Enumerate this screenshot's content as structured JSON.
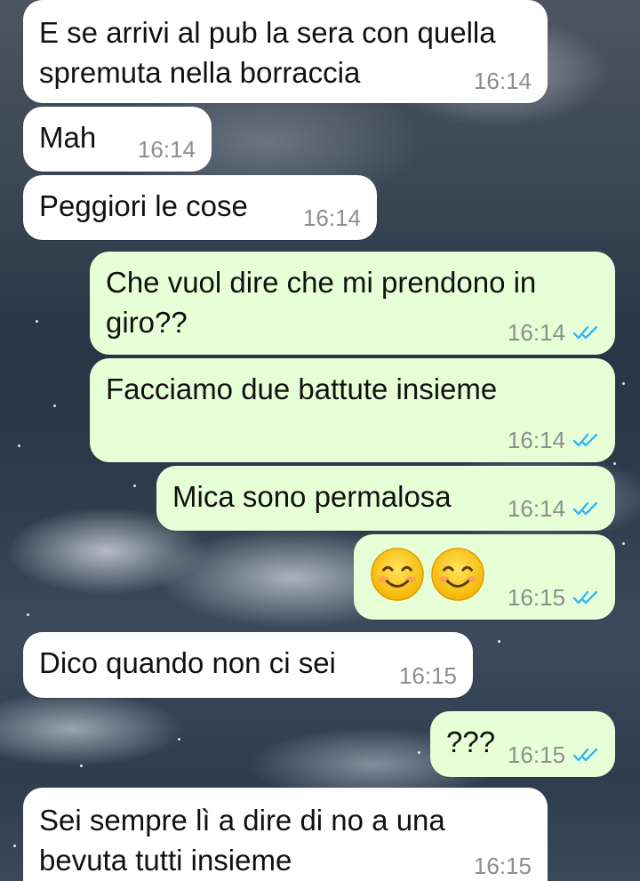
{
  "colors": {
    "incoming_bubble": "#ffffff",
    "outgoing_bubble": "#e6ffd7",
    "timestamp": "#8e8e8e",
    "read_ticks": "#34b7f1"
  },
  "messages": [
    {
      "direction": "incoming",
      "text": "E se arrivi al pub la sera con quella\nspremuta nella borraccia",
      "time": "16:14"
    },
    {
      "direction": "incoming",
      "text": "Mah",
      "time": "16:14"
    },
    {
      "direction": "incoming",
      "text": "Peggiori le cose",
      "time": "16:14"
    },
    {
      "direction": "outgoing",
      "text": "Che vuol dire che mi prendono in\ngiro??",
      "time": "16:14",
      "status": "read"
    },
    {
      "direction": "outgoing",
      "text": "Facciamo due battute insieme",
      "time": "16:14",
      "status": "read"
    },
    {
      "direction": "outgoing",
      "text": "Mica sono permalosa",
      "time": "16:14",
      "status": "read"
    },
    {
      "direction": "outgoing",
      "emoji": [
        "smiling-face-icon",
        "smiling-face-icon"
      ],
      "time": "16:15",
      "status": "read"
    },
    {
      "direction": "incoming",
      "text": "Dico quando non ci sei",
      "time": "16:15"
    },
    {
      "direction": "outgoing",
      "text": "???",
      "time": "16:15",
      "status": "read"
    },
    {
      "direction": "incoming",
      "text": "Sei sempre lì a dire di no a una\nbevuta tutti insieme",
      "time": "16:15"
    }
  ]
}
